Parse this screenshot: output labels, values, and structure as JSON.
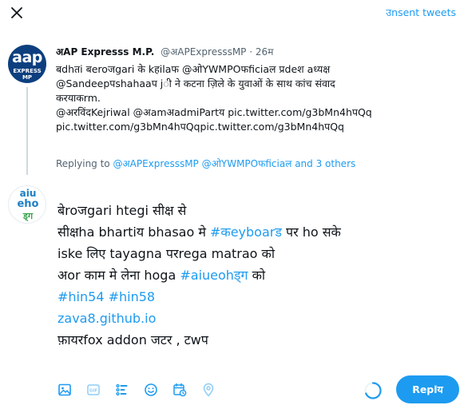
{
  "header": {
    "unsent_label": "उnsent tweets"
  },
  "parent_tweet": {
    "avatar_line1": "aap",
    "avatar_line2": "EXPRESS MP",
    "name": "अAP Expresss M.P.",
    "handle": "@अAPExpresssMP",
    "separator": "·",
    "time": "26म",
    "lines": [
      "बdhतi बeroजgari के kहilaफ @ओYWMPOफficiaल प्रdeश aध्यक्ष",
      "@Sandeepपshahaaप jी ने कटना ज़िले के युवाओं के साथ कांच संवाद",
      "करयाकrm.",
      "@अरविंदKejriwal @अamअadmiPartय pic.twitter.com/g3bMn4hपQq",
      "pic.twitter.com/g3bMn4hपQqpic.twitter.com/g3bMn4hपQq"
    ]
  },
  "replying": {
    "prefix": "Replying to",
    "handles": "@अAPExpresssMP @ओYWMPOफficiaल",
    "suffix": "and 3 others"
  },
  "reply_avatar": {
    "line1": "aiu",
    "line2": "eho",
    "line3": "ड्ग"
  },
  "compose": {
    "line1": "बेroजgari htegi सीक्ष से",
    "line2_a": "सीक्षha bhartiय bhasao मे ",
    "line2_b": "#कeyboarड",
    "line2_c": " पर ho सके",
    "line3": "iske लिए tayagna परrega matrao को",
    "line4_a": "अor काम मे लेना hoga ",
    "line4_b": "#aiueohड्ग",
    "line4_c": " को",
    "line5": "#hin54 #hin58",
    "line6": "zava8.github.io",
    "line7": "फ़ायरfox addon जटर , टwप"
  },
  "toolbar": {
    "icons": [
      "image-icon",
      "gif-icon",
      "poll-icon",
      "emoji-icon",
      "schedule-icon",
      "location-icon"
    ]
  },
  "reply_button": {
    "label": "Replय"
  },
  "colors": {
    "accent": "#1d9bf0",
    "text": "#0f1419",
    "muted": "#536471"
  }
}
